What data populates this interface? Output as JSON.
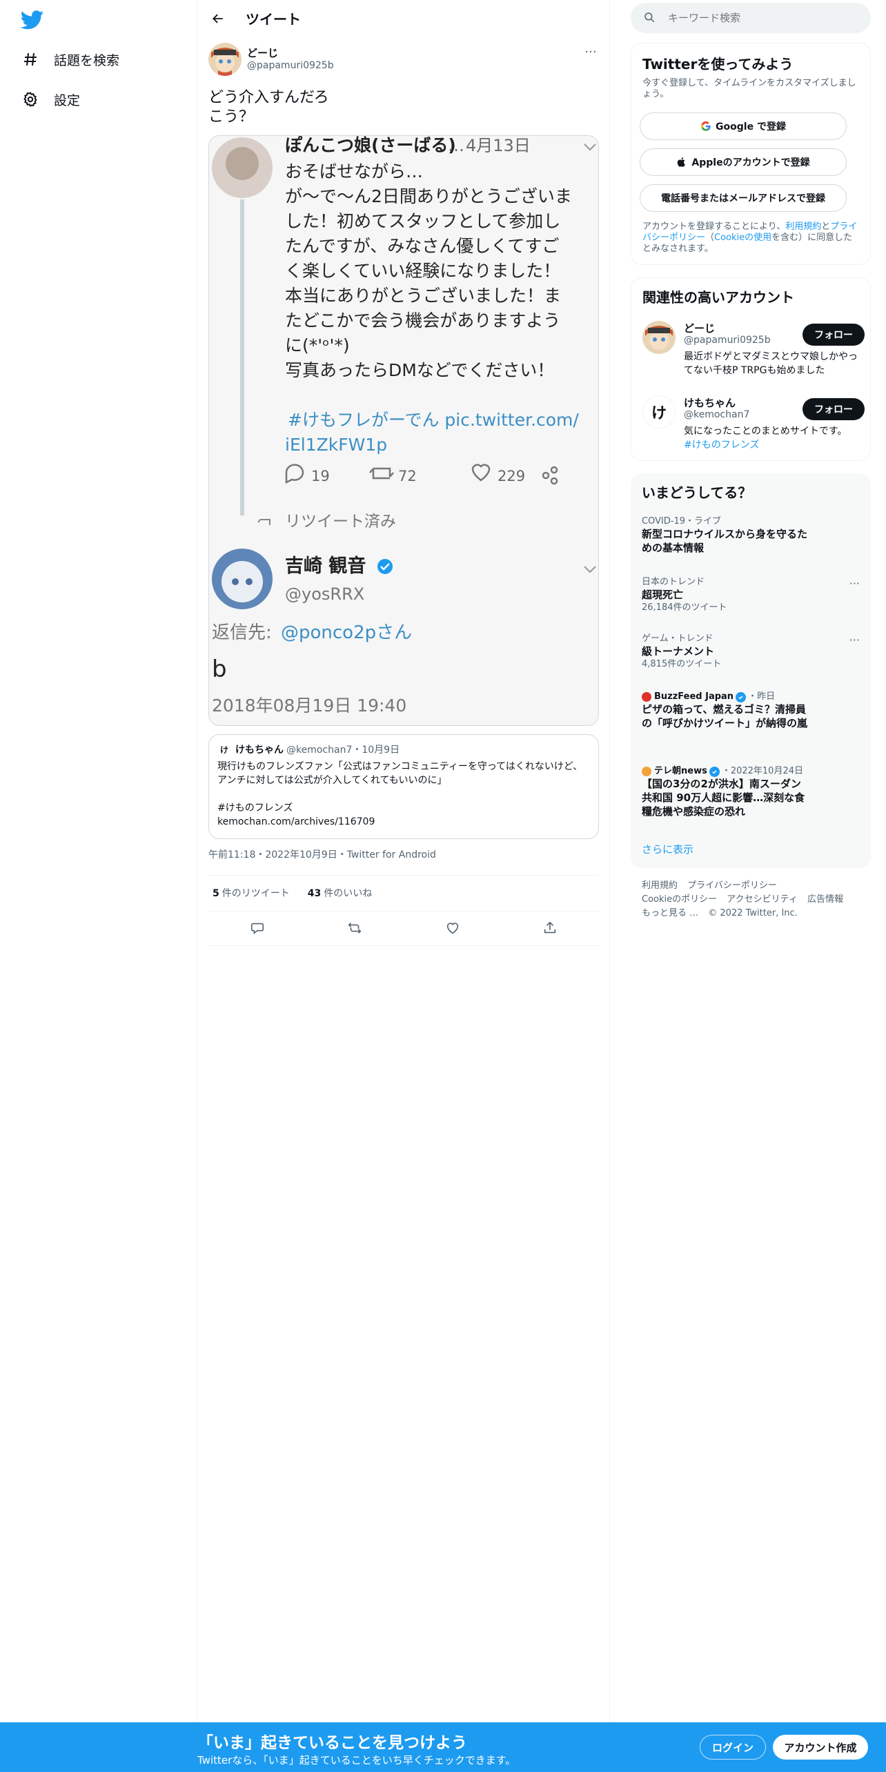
{
  "nav": {
    "items": [
      {
        "label": "話題を検索",
        "icon": "hashtag-icon"
      },
      {
        "label": "設定",
        "icon": "gear-icon"
      }
    ]
  },
  "header": {
    "title": "ツイート"
  },
  "tweet": {
    "author_name": "どーじ",
    "author_handle": "@papamuri0925b",
    "text_lines": [
      "どう介入すんだろ",
      "こう？"
    ],
    "timestamp": "午前11:18・2022年10月9日・Twitter for Android",
    "retweets": "5",
    "retweets_label": "件のリツイート",
    "likes": "43",
    "likes_label": "件のいいね"
  },
  "media": {
    "first_name": "ぽんこつ娘(さーばる)",
    "first_date": "4月13日",
    "first_lines": [
      "おそばせながら…",
      "が～で～ん2日間ありがとうございま",
      "した！初めてスタッフとして参加し",
      "たんですが、みなさん優しくてすご",
      "く楽しくていい経験になりました！",
      "本当にありがとうございました！ま",
      "たどこかで会う機会がありますよう",
      "に(*'ᵒ'*)",
      "写真あったらDMなどでください！"
    ],
    "first_hashtag": "#けもフレがーでん pic.twitter.com/",
    "first_link_tail": "iEl1ZkFW1p",
    "reply_count": "19",
    "retweet_count": "72",
    "like_count": "229",
    "retweeted_label": "リツイート済み",
    "second_name": "吉崎 観音",
    "second_handle": "@yosRRX",
    "reply_to_prefix": "返信先: ",
    "reply_to": "@ponco2pさん",
    "second_text": "b",
    "second_date": "2018年08月19日 19:40"
  },
  "quote": {
    "avatar_char": "け",
    "name": "けもちゃん",
    "handle_date": "@kemochan7・10月9日",
    "text": "現行けものフレンズファン「公式はファンコミュニティーを守ってはくれないけど、アンチに対しては公式が介入してくれてもいいのに」",
    "hashtag": "#けものフレンズ",
    "link": "kemochan.com/archives/116709"
  },
  "search": {
    "placeholder": "キーワード検索"
  },
  "signup": {
    "title": "Twitterを使ってみよう",
    "subtitle": "今すぐ登録して、タイムラインをカスタマイズしましょう。",
    "google_label": "Google で登録",
    "apple_label": "Appleのアカウントで登録",
    "phone_label": "電話番号またはメールアドレスで登録",
    "legal_prefix": "アカウントを登録することにより、",
    "legal_terms": "利用規約",
    "legal_and": "と",
    "legal_privacy": "プライバシーポリシー",
    "legal_cookie_open": "（",
    "legal_cookie": "Cookieの使用",
    "legal_suffix": "を含む）に同意したとみなされます。"
  },
  "related": {
    "title": "関連性の高いアカウント",
    "accounts": [
      {
        "name": "どーじ",
        "handle": "@papamuri0925b",
        "bio": "最近ボドゲとマダミスとウマ娘しかやってない千枝P TRPGも始めました",
        "follow": "フォロー"
      },
      {
        "name": "けもちゃん",
        "handle": "@kemochan7",
        "avatar_char": "け",
        "bio": "気になったことのまとめサイトです。",
        "bio_link": "#けものフレンズ",
        "follow": "フォロー"
      }
    ]
  },
  "trends": {
    "title": "いまどうしてる？",
    "items": [
      {
        "category": "COVID-19・ライブ",
        "title": "新型コロナウイルスから身を守るための基本情報"
      },
      {
        "category": "日本のトレンド",
        "title": "超現死亡",
        "count": "26,184件のツイート"
      },
      {
        "category": "ゲーム・トレンド",
        "title": "級トーナメント",
        "count": "4,815件のツイート"
      },
      {
        "source": "BuzzFeed Japan",
        "time": "・昨日",
        "title": "ピザの箱って、燃えるゴミ？清掃員の「呼びかけツイート」が納得の嵐"
      },
      {
        "source": "テレ朝news",
        "time": "・2022年10月24日",
        "title": "【国の3分の2が洪水】南スーダン共和国 90万人超に影響…深刻な食糧危機や感染症の恐れ"
      }
    ],
    "show_more": "さらに表示"
  },
  "footer": {
    "links": [
      "利用規約",
      "プライバシーポリシー",
      "Cookieのポリシー",
      "アクセシビリティ",
      "広告情報",
      "もっと見る …",
      "© 2022 Twitter, Inc."
    ]
  },
  "bottombar": {
    "title": "「いま」起きていることを見つけよう",
    "subtitle": "Twitterなら、「いま」起きていることをいち早くチェックできます。",
    "login": "ログイン",
    "signup": "アカウント作成"
  },
  "colors": {
    "accent": "#1d9bf0",
    "text": "#0f1419",
    "muted": "#536471",
    "border": "#eff3f4"
  }
}
